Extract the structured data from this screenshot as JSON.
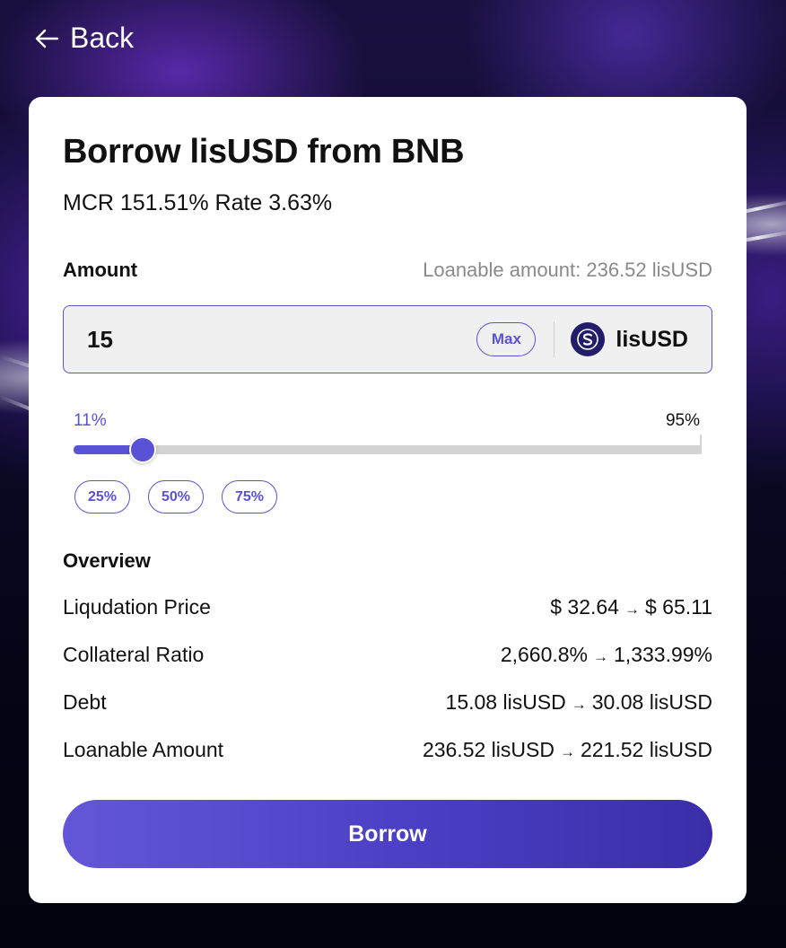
{
  "nav": {
    "back_label": "Back"
  },
  "card": {
    "title": "Borrow lisUSD from BNB",
    "subtitle": "MCR 151.51% Rate 3.63%",
    "amount_label": "Amount",
    "loanable_text": "Loanable amount: 236.52 lisUSD",
    "input_value": "15",
    "max_label": "Max",
    "token_name": "lisUSD",
    "token_icon": "lisusd-token-icon",
    "slider": {
      "current_label": "11%",
      "max_label": "95%",
      "value_percent": 11,
      "max_percent": 95
    },
    "quick_buttons": [
      "25%",
      "50%",
      "75%"
    ],
    "overview": {
      "title": "Overview",
      "rows": [
        {
          "label": "Liqudation Price",
          "from": "$ 32.64",
          "to": "$ 65.11"
        },
        {
          "label": "Collateral Ratio",
          "from": "2,660.8%",
          "to": "1,333.99%"
        },
        {
          "label": "Debt",
          "from": "15.08 lisUSD",
          "to": "30.08 lisUSD"
        },
        {
          "label": "Loanable Amount",
          "from": "236.52 lisUSD",
          "to": "221.52 lisUSD"
        }
      ]
    },
    "borrow_label": "Borrow"
  },
  "colors": {
    "accent": "#5a52d6",
    "token_bg": "#211d6b",
    "muted_text": "#8a8a8a"
  }
}
